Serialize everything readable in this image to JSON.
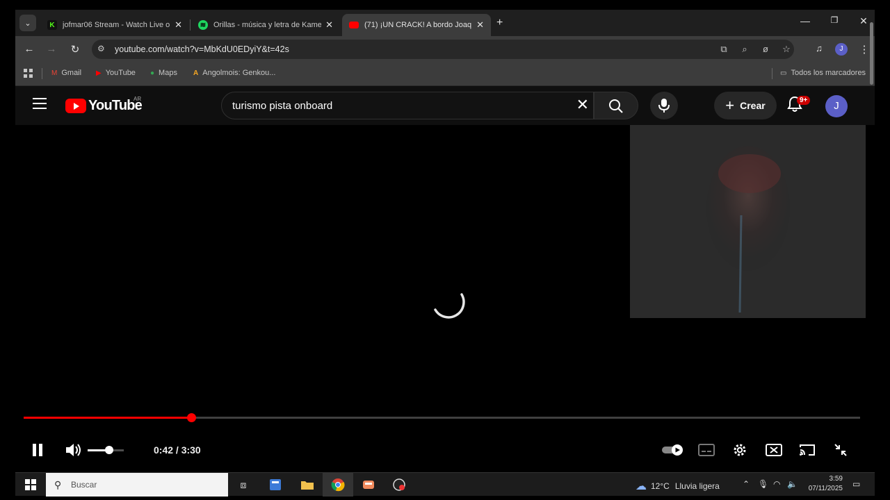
{
  "browser": {
    "tabs": [
      {
        "title": "jofmar06 Stream - Watch Live o",
        "favicon": "kick-icon",
        "color": "#53fc18"
      },
      {
        "title": "Orillas - música y letra de Kame",
        "favicon": "spotify-icon",
        "color": "#1ed760"
      },
      {
        "title": "(71) ¡UN CRACK! A bordo Joaq",
        "favicon": "youtube-icon",
        "color": "#ff0000",
        "active": true
      }
    ],
    "new_tab": "+",
    "url": "youtube.com/watch?v=MbKdU0EDyiY&t=42s",
    "profile_initial": "J",
    "bookmarks": [
      {
        "label": "Gmail"
      },
      {
        "label": "YouTube"
      },
      {
        "label": "Maps"
      },
      {
        "label": "Angolmois: Genkou..."
      }
    ],
    "all_bookmarks": "Todos los marcadores"
  },
  "youtube": {
    "logo_text": "YouTube",
    "region": "AR",
    "search_query": "turismo pista onboard",
    "create_label": "Crear",
    "notifications": "9+",
    "avatar_initial": "J",
    "accent": "#ff0000"
  },
  "player": {
    "current_time": "0:42",
    "duration": "3:30",
    "time_display": "0:42 / 3:30",
    "progress_fraction": 0.2,
    "volume_fraction": 0.6,
    "autoplay": "on"
  },
  "taskbar": {
    "search_placeholder": "Buscar",
    "weather_temp": "12°C",
    "weather_desc": "Lluvia ligera",
    "time": "3:59",
    "date": "07/11/2025"
  }
}
